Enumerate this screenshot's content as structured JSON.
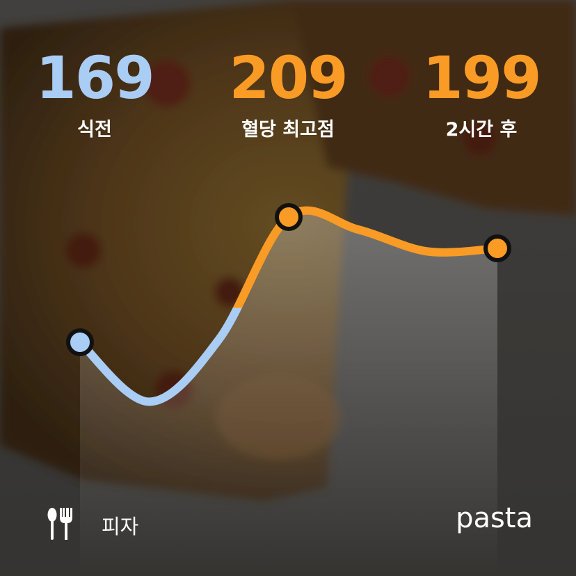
{
  "colors": {
    "before": "#a9cdf5",
    "rise": "#f99b25",
    "text": "#ffffff",
    "dot_stroke": "#111111"
  },
  "stats": {
    "before": {
      "value": "169",
      "label": "식전",
      "color": "#a9cdf5"
    },
    "peak": {
      "value": "209",
      "label": "혈당 최고점",
      "color": "#f99b25"
    },
    "after": {
      "value": "199",
      "label": "2시간 후",
      "color": "#f99b25"
    }
  },
  "meal": {
    "icon": "utensils-icon",
    "label": "피자"
  },
  "brand": {
    "name": "pasta"
  },
  "chart_data": {
    "type": "line",
    "title": "",
    "xlabel": "",
    "ylabel": "",
    "series": [
      {
        "values": [
          169,
          150,
          170,
          209,
          205,
          198,
          199
        ]
      }
    ],
    "x": [
      0,
      1,
      2,
      3,
      4,
      5,
      6
    ],
    "highlighted_points": [
      {
        "label": "식전",
        "value": 169
      },
      {
        "label": "혈당 최고점",
        "value": 209
      },
      {
        "label": "2시간 후",
        "value": 199
      }
    ],
    "threshold": 180,
    "ylim": [
      145,
      215
    ],
    "grid": false
  }
}
